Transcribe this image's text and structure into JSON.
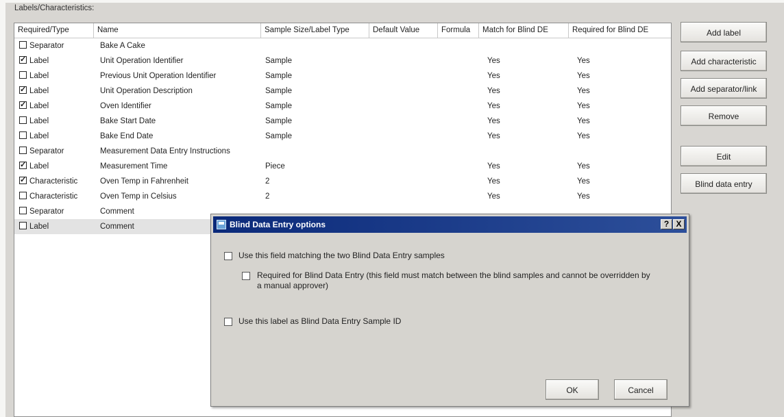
{
  "group_label": "Labels/Characteristics:",
  "columns": [
    "Required/Type",
    "Name",
    "Sample Size/Label Type",
    "Default Value",
    "Formula",
    "Match for Blind DE",
    "Required for Blind DE"
  ],
  "rows": [
    {
      "checked": false,
      "type": "Separator",
      "name": "Bake A Cake",
      "sample": "",
      "default": "",
      "formula": "",
      "match": "",
      "required": ""
    },
    {
      "checked": true,
      "type": "Label",
      "name": "Unit Operation Identifier",
      "sample": "Sample",
      "default": "",
      "formula": "",
      "match": "Yes",
      "required": "Yes"
    },
    {
      "checked": false,
      "type": "Label",
      "name": "Previous Unit Operation Identifier",
      "sample": "Sample",
      "default": "",
      "formula": "",
      "match": "Yes",
      "required": "Yes"
    },
    {
      "checked": true,
      "type": "Label",
      "name": "Unit Operation Description",
      "sample": "Sample",
      "default": "",
      "formula": "",
      "match": "Yes",
      "required": "Yes"
    },
    {
      "checked": true,
      "type": "Label",
      "name": "Oven Identifier",
      "sample": "Sample",
      "default": "",
      "formula": "",
      "match": "Yes",
      "required": "Yes"
    },
    {
      "checked": false,
      "type": "Label",
      "name": "Bake Start Date",
      "sample": "Sample",
      "default": "",
      "formula": "",
      "match": "Yes",
      "required": "Yes"
    },
    {
      "checked": false,
      "type": "Label",
      "name": "Bake End Date",
      "sample": "Sample",
      "default": "",
      "formula": "",
      "match": "Yes",
      "required": "Yes"
    },
    {
      "checked": false,
      "type": "Separator",
      "name": "Measurement Data Entry Instructions",
      "sample": "",
      "default": "",
      "formula": "",
      "match": "",
      "required": ""
    },
    {
      "checked": true,
      "type": "Label",
      "name": "Measurement Time",
      "sample": "Piece",
      "default": "",
      "formula": "",
      "match": "Yes",
      "required": "Yes"
    },
    {
      "checked": true,
      "type": "Characteristic",
      "name": "Oven Temp in Fahrenheit",
      "sample": "2",
      "default": "",
      "formula": "",
      "match": "Yes",
      "required": "Yes"
    },
    {
      "checked": false,
      "type": "Characteristic",
      "name": "Oven Temp in Celsius",
      "sample": "2",
      "default": "",
      "formula": "",
      "match": "Yes",
      "required": "Yes"
    },
    {
      "checked": false,
      "type": "Separator",
      "name": "Comment",
      "sample": "",
      "default": "",
      "formula": "",
      "match": "",
      "required": ""
    },
    {
      "checked": false,
      "type": "Label",
      "name": "Comment",
      "sample": "",
      "default": "",
      "formula": "",
      "match": "",
      "required": "",
      "selected": true
    }
  ],
  "buttons": {
    "add_label": "Add label",
    "add_characteristic": "Add characteristic",
    "add_separator": "Add separator/link",
    "remove": "Remove",
    "edit": "Edit",
    "blind_data_entry": "Blind data entry"
  },
  "dialog": {
    "title": "Blind Data Entry options",
    "help_glyph": "?",
    "close_glyph": "X",
    "option1": "Use this field matching the two Blind Data Entry samples",
    "option2": "Required for Blind Data Entry (this field must match between the blind samples and cannot be overridden by a manual approver)",
    "option3": "Use this label as Blind Data Entry Sample ID",
    "ok": "OK",
    "cancel": "Cancel"
  }
}
